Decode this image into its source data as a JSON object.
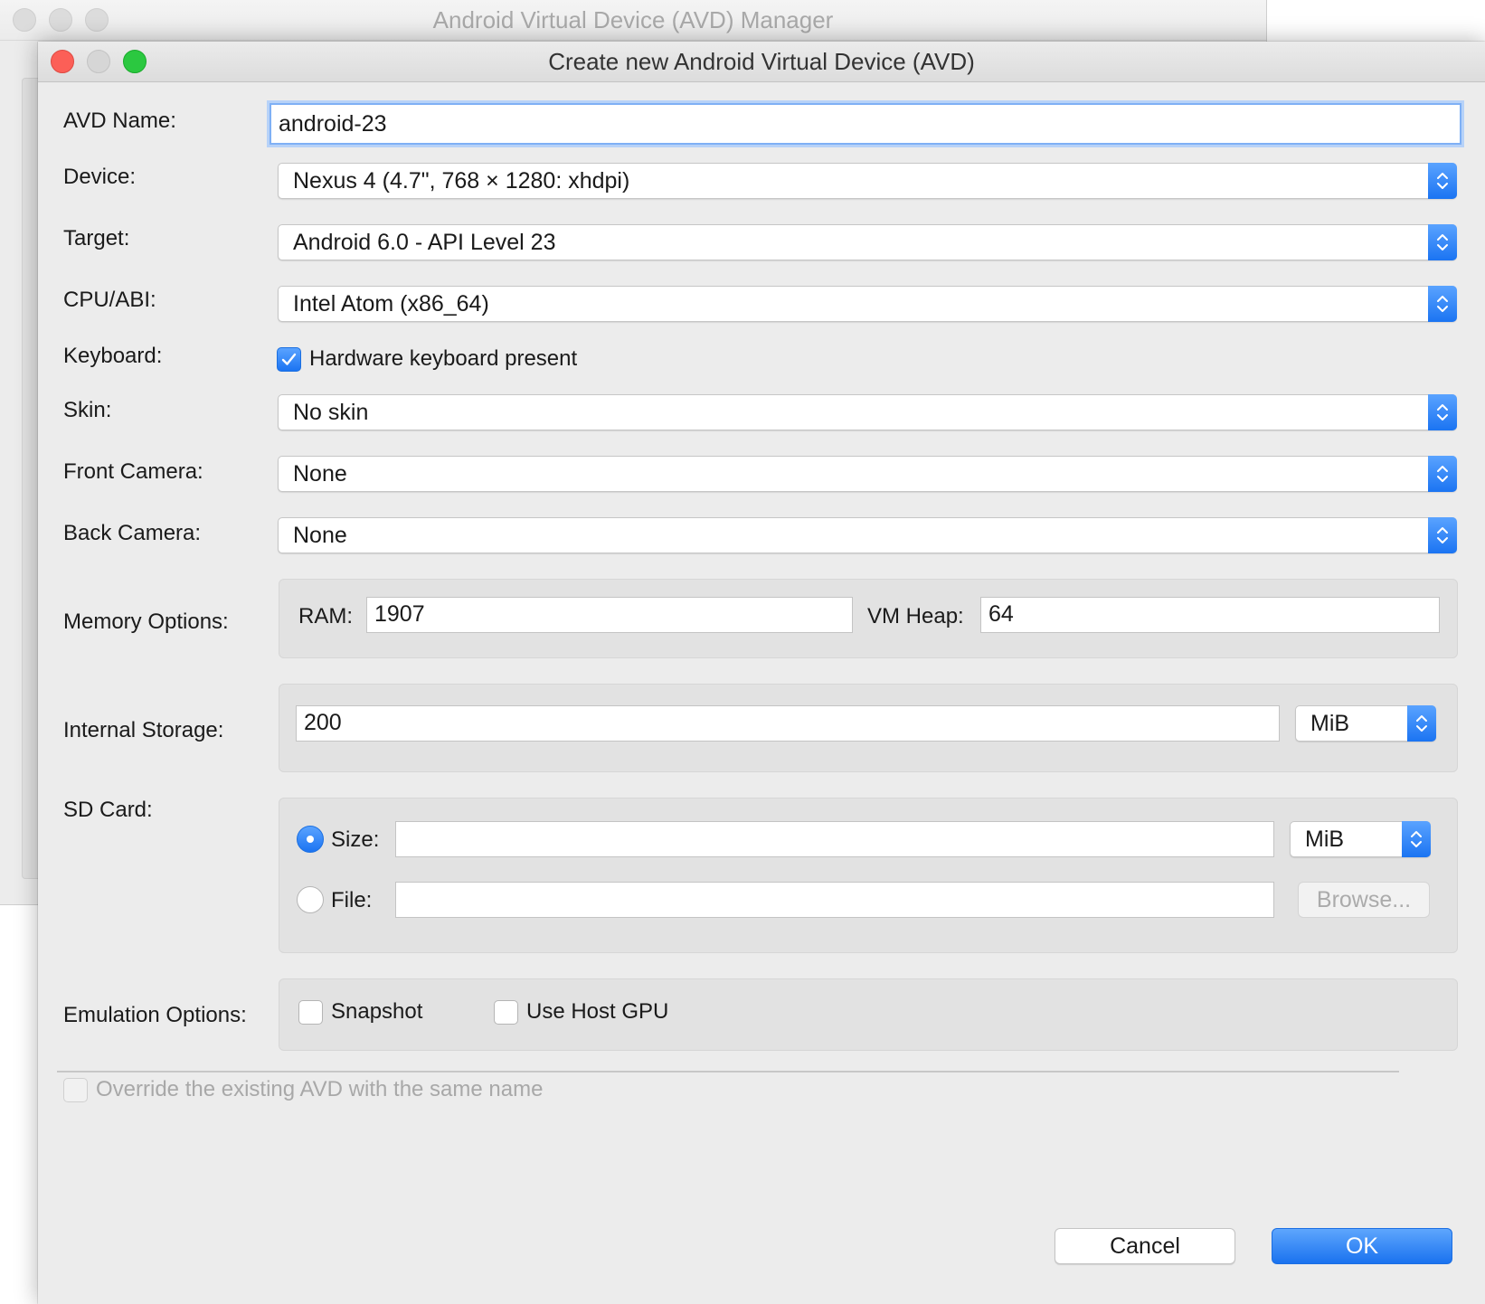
{
  "background_window": {
    "title": "Android Virtual Device (AVD) Manager"
  },
  "dialog": {
    "title": "Create new Android Virtual Device (AVD)",
    "fields": {
      "avd_name": {
        "label": "AVD Name:",
        "value": "android-23"
      },
      "device": {
        "label": "Device:",
        "value": "Nexus 4 (4.7\", 768 × 1280: xhdpi)"
      },
      "target": {
        "label": "Target:",
        "value": "Android 6.0 - API Level 23"
      },
      "cpu_abi": {
        "label": "CPU/ABI:",
        "value": "Intel Atom (x86_64)"
      },
      "keyboard": {
        "label": "Keyboard:",
        "checkbox_label": "Hardware keyboard present",
        "checked": true
      },
      "skin": {
        "label": "Skin:",
        "value": "No skin"
      },
      "front_camera": {
        "label": "Front Camera:",
        "value": "None"
      },
      "back_camera": {
        "label": "Back Camera:",
        "value": "None"
      },
      "memory": {
        "label": "Memory Options:",
        "ram_label": "RAM:",
        "ram_value": "1907",
        "vm_heap_label": "VM Heap:",
        "vm_heap_value": "64"
      },
      "internal_storage": {
        "label": "Internal Storage:",
        "value": "200",
        "unit": "MiB"
      },
      "sd_card": {
        "label": "SD Card:",
        "size_label": "Size:",
        "size_value": "",
        "size_unit": "MiB",
        "size_selected": true,
        "file_label": "File:",
        "file_value": "",
        "browse_label": "Browse..."
      },
      "emulation": {
        "label": "Emulation Options:",
        "snapshot_label": "Snapshot",
        "snapshot_checked": false,
        "host_gpu_label": "Use Host GPU",
        "host_gpu_checked": false
      },
      "override": {
        "label": "Override the existing AVD with the same name",
        "checked": false,
        "enabled": false
      }
    },
    "buttons": {
      "cancel": "Cancel",
      "ok": "OK"
    }
  },
  "colors": {
    "accent": "#1b74f2",
    "focus_ring": "#b7d2f8",
    "close": "#fc5f57",
    "zoom": "#2bc840",
    "window_bg": "#ececec",
    "group_bg": "#e2e2e2"
  }
}
